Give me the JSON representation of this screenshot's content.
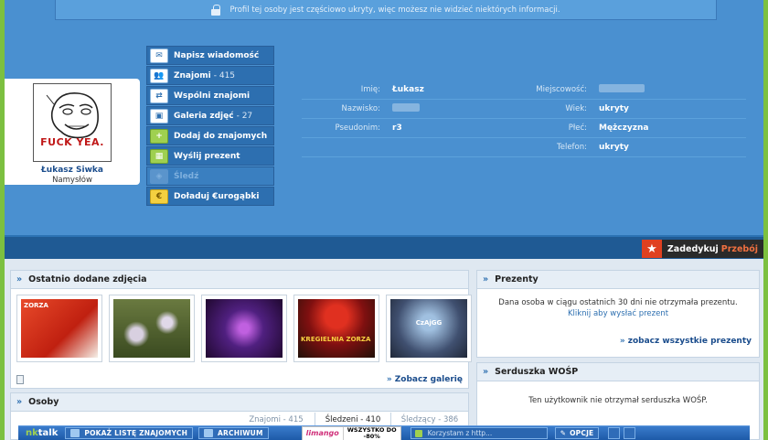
{
  "privacy_notice": "Profil tej osoby jest częściowo ukryty, więc możesz nie widzieć niektórych informacji.",
  "profile": {
    "avatar_caption": "FUCK YEA.",
    "name": "Łukasz Siwka",
    "city": "Namysłów"
  },
  "actions": [
    {
      "label": "Napisz wiadomość",
      "count": "",
      "icon": "envelope-icon"
    },
    {
      "label": "Znajomi",
      "count": "- 415",
      "icon": "friends-icon"
    },
    {
      "label": "Wspólni znajomi",
      "count": "",
      "icon": "mutual-friends-icon"
    },
    {
      "label": "Galeria zdjęć",
      "count": "- 27",
      "icon": "camera-icon"
    },
    {
      "label": "Dodaj do znajomych",
      "count": "",
      "icon": "add-friend-icon"
    },
    {
      "label": "Wyślij prezent",
      "count": "",
      "icon": "gift-icon"
    },
    {
      "label": "Śledź",
      "count": "",
      "icon": "follow-icon"
    },
    {
      "label": "Doładuj €urogąbki",
      "count": "",
      "icon": "coins-icon"
    }
  ],
  "info": {
    "imie_label": "Imię:",
    "imie_value": "Łukasz",
    "nazwisko_label": "Nazwisko:",
    "pseudonim_label": "Pseudonim:",
    "pseudonim_value": "r3",
    "miejscowosc_label": "Miejscowość:",
    "wiek_label": "Wiek:",
    "wiek_value": "ukryty",
    "plec_label": "Płeć:",
    "plec_value": "Mężczyzna",
    "telefon_label": "Telefon:",
    "telefon_value": "ukryty"
  },
  "dedicate": {
    "label": "Zadedykuj",
    "accent": "Przebój"
  },
  "photos_panel": {
    "title": "Ostatnio dodane zdjęcia",
    "gallery_link": "Zobacz galerię",
    "thumbs": [
      {
        "text": "ZORZA"
      },
      {
        "text": ""
      },
      {
        "text": ""
      },
      {
        "text": "KREGIELNIA ZORZA"
      },
      {
        "text": "CzAjGG"
      }
    ]
  },
  "gifts_panel": {
    "title": "Prezenty",
    "message": "Dana osoba w ciągu ostatnich 30 dni nie otrzymała prezentu.",
    "link": "Kliknij aby wysłać prezent",
    "see_all": "zobacz wszystkie prezenty"
  },
  "people_panel": {
    "title": "Osoby",
    "tabs": [
      "Znajomi - 415",
      "Śledzeni - 410",
      "Śledzący - 386"
    ]
  },
  "wosp_panel": {
    "title": "Serduszka WOŚP",
    "message": "Ten użytkownik nie otrzymał serduszka WOŚP."
  },
  "nktalk": {
    "logo_a": "nk",
    "logo_b": "talk",
    "show_friends": "POKAŻ LISTĘ ZNAJOMYCH",
    "archive": "ARCHIWUM",
    "ad_brand": "limango",
    "ad_line1": "WSZYSTKO DO",
    "ad_line2": "-80%",
    "status_placeholder": "Korzystam z http...",
    "options": "OPCJE"
  }
}
